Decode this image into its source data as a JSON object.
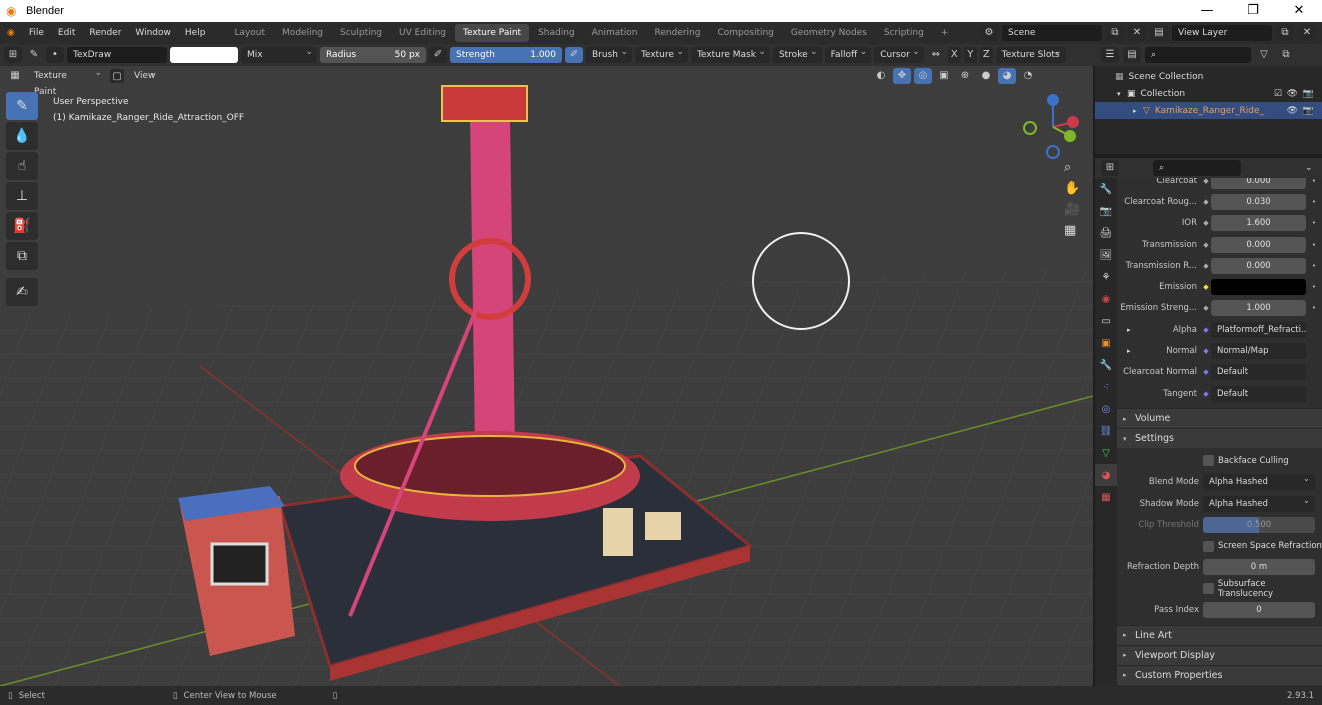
{
  "window": {
    "title": "Blender",
    "controls": [
      "minimize",
      "maximize",
      "close"
    ]
  },
  "menu": {
    "items": [
      "File",
      "Edit",
      "Render",
      "Window",
      "Help"
    ],
    "workspaces": [
      "Layout",
      "Modeling",
      "Sculpting",
      "UV Editing",
      "Texture Paint",
      "Shading",
      "Animation",
      "Rendering",
      "Compositing",
      "Geometry Nodes",
      "Scripting"
    ],
    "active_workspace": "Texture Paint",
    "add_tab": "+",
    "scene": "Scene",
    "view_layer": "View Layer"
  },
  "tool_header": {
    "brush_name": "TexDraw",
    "color_swatch": "#ffffff",
    "blend_mode": "Mix",
    "radius_label": "Radius",
    "radius_value": "50 px",
    "strength_label": "Strength",
    "strength_value": "1.000",
    "menus": [
      "Brush",
      "Texture",
      "Texture Mask",
      "Stroke",
      "Falloff",
      "Cursor"
    ],
    "mirror_axes": [
      "X",
      "Y",
      "Z"
    ],
    "texture_slots": "Texture Slots"
  },
  "view_header": {
    "mode": "Texture Paint",
    "view_menu": "View"
  },
  "viewport": {
    "perspective": "User Perspective",
    "object_info": "(1) Kamikaze_Ranger_Ride_Attraction_OFF",
    "gizmo_axes": [
      "X",
      "Y",
      "Z"
    ]
  },
  "toolbar": {
    "tools": [
      "draw",
      "soften",
      "smear",
      "clone",
      "fill",
      "mask",
      "annotate"
    ],
    "active": "draw"
  },
  "outliner": {
    "search_placeholder": "",
    "rows": [
      {
        "label": "Scene Collection",
        "level": 0
      },
      {
        "label": "Collection",
        "level": 1
      },
      {
        "label": "Kamikaze_Ranger_Ride_",
        "level": 2,
        "selected": true
      }
    ]
  },
  "properties": {
    "rows": [
      {
        "label": "Clearcoat",
        "value": "0.000",
        "type": "num"
      },
      {
        "label": "Clearcoat Roug...",
        "value": "0.030",
        "type": "num"
      },
      {
        "label": "IOR",
        "value": "1.600",
        "type": "num"
      },
      {
        "label": "Transmission",
        "value": "0.000",
        "type": "num"
      },
      {
        "label": "Transmission R...",
        "value": "0.000",
        "type": "num"
      },
      {
        "label": "Emission",
        "value": "",
        "type": "color",
        "color": "#000000"
      },
      {
        "label": "Emission Streng...",
        "value": "1.000",
        "type": "num"
      },
      {
        "label": "Alpha",
        "value": "Platformoff_Refracti...",
        "type": "link"
      },
      {
        "label": "Normal",
        "value": "Normal/Map",
        "type": "link"
      },
      {
        "label": "Clearcoat Normal",
        "value": "Default",
        "type": "link"
      },
      {
        "label": "Tangent",
        "value": "Default",
        "type": "link"
      }
    ],
    "sections": {
      "volume": "Volume",
      "settings": "Settings",
      "line_art": "Line Art",
      "viewport_display": "Viewport Display",
      "custom_properties": "Custom Properties"
    },
    "settings": {
      "backface_culling": "Backface Culling",
      "blend_mode_label": "Blend Mode",
      "blend_mode": "Alpha Hashed",
      "shadow_mode_label": "Shadow Mode",
      "shadow_mode": "Alpha Hashed",
      "clip_threshold_label": "Clip Threshold",
      "clip_threshold": "0.500",
      "screen_space_refraction": "Screen Space Refraction",
      "refraction_depth_label": "Refraction Depth",
      "refraction_depth": "0 m",
      "subsurface_translucency": "Subsurface Translucency",
      "pass_index_label": "Pass Index",
      "pass_index": "0"
    }
  },
  "status_bar": {
    "select": "Select",
    "center_view": "Center View to Mouse",
    "version": "2.93.1"
  }
}
